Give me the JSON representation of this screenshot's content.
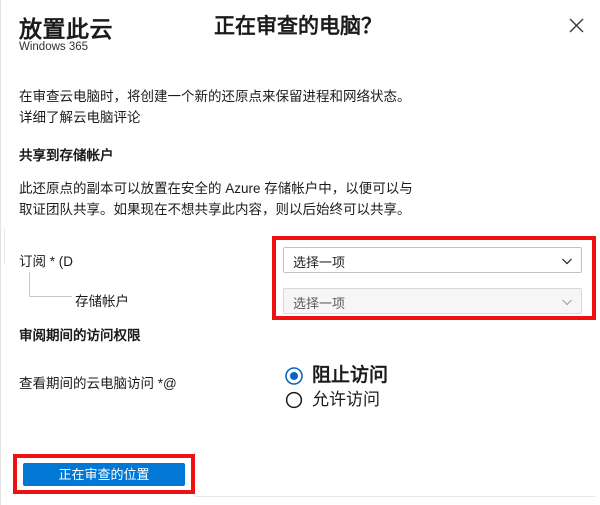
{
  "header": {
    "brand_title": "放置此云",
    "brand_subtitle": "Windows 365",
    "main_title": "正在审查的电脑？",
    "close_icon": "close-icon"
  },
  "body": {
    "intro_paragraph": "在审查云电脑时，将创建一个新的还原点来保留进程和网络状态。详细了解云电脑评论",
    "share_section_heading": "共享到存储帐户",
    "storage_paragraph": "此还原点的副本可以放置在安全的 Azure 存储帐户中，以便可以与取证团队共享。如果现在不想共享此内容，则以后始终可以共享。",
    "subscription_label": "订阅 * (D",
    "storage_account_label": "存储帐户",
    "access_section_heading": "审阅期间的访问权限",
    "cloudpc_access_label": "查看期间的云电脑访问 *@"
  },
  "dropdowns": [
    {
      "name": "subscription-dropdown",
      "value": "选择一项",
      "chevron_icon": "chevron-down-icon",
      "disabled": false
    },
    {
      "name": "storage-account-dropdown",
      "value": "选择一项",
      "chevron_icon": "chevron-down-icon",
      "disabled": true
    }
  ],
  "radios": [
    {
      "label": "阻止访问",
      "selected": true
    },
    {
      "label": "允许访问",
      "selected": false
    }
  ],
  "footer": {
    "primary_button_label": "正在审查的位置"
  },
  "colors": {
    "accent_blue": "#0078d4",
    "highlight_red": "#ee1111",
    "text": "#1b1b1b",
    "border": "#c2c2c2"
  }
}
